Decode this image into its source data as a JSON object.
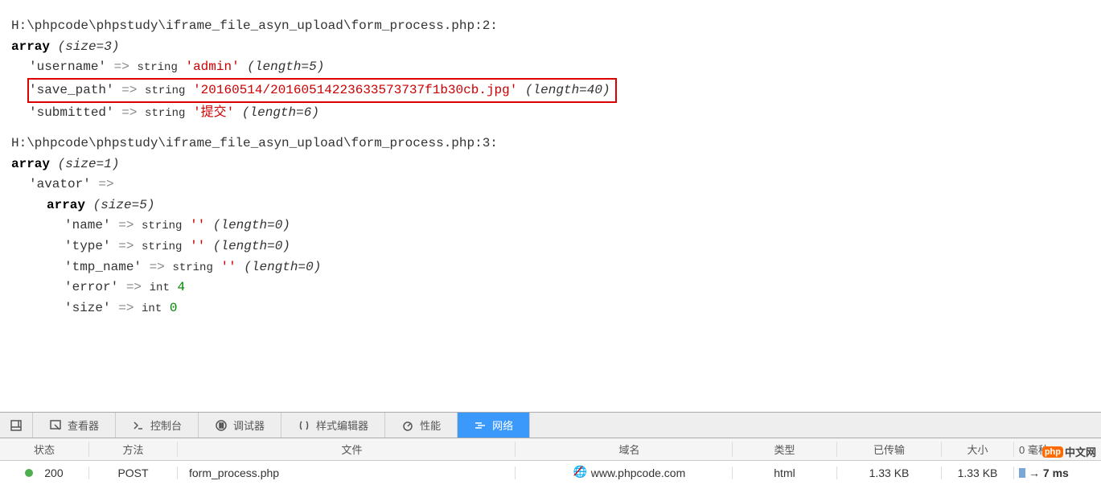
{
  "dump1": {
    "path": "H:\\phpcode\\phpstudy\\iframe_file_asyn_upload\\form_process.php:2:",
    "size_label": "(size=3)",
    "rows": [
      {
        "key": "'username'",
        "type": "string",
        "value": "'admin'",
        "len": "(length=5)",
        "highlight": false
      },
      {
        "key": "'save_path'",
        "type": "string",
        "value": "'20160514/20160514223633573737f1b30cb.jpg'",
        "len": "(length=40)",
        "highlight": true
      },
      {
        "key": "'submitted'",
        "type": "string",
        "value": "'提交'",
        "len": "(length=6)",
        "highlight": false
      }
    ]
  },
  "dump2": {
    "path": "H:\\phpcode\\phpstudy\\iframe_file_asyn_upload\\form_process.php:3:",
    "outer_size": "(size=1)",
    "outer_key": "'avator'",
    "inner_size": "(size=5)",
    "rows": [
      {
        "key": "'name'",
        "type": "string",
        "value": "''",
        "len": "(length=0)"
      },
      {
        "key": "'type'",
        "type": "string",
        "value": "''",
        "len": "(length=0)"
      },
      {
        "key": "'tmp_name'",
        "type": "string",
        "value": "''",
        "len": "(length=0)"
      },
      {
        "key": "'error'",
        "type": "int",
        "value": "4",
        "len": ""
      },
      {
        "key": "'size'",
        "type": "int",
        "value": "0",
        "len": ""
      }
    ]
  },
  "tabs": {
    "inspector": "查看器",
    "console": "控制台",
    "debugger": "调试器",
    "style": "样式编辑器",
    "performance": "性能",
    "network": "网络"
  },
  "net_headers": {
    "status": "状态",
    "method": "方法",
    "file": "文件",
    "domain": "域名",
    "type": "类型",
    "transferred": "已传输",
    "size": "大小",
    "timeline": "0 毫秒"
  },
  "net_row": {
    "status": "200",
    "method": "POST",
    "file": "form_process.php",
    "domain": "www.phpcode.com",
    "type": "html",
    "transferred": "1.33 KB",
    "size": "1.33 KB",
    "time": "→ 7 ms"
  },
  "array_kw": "array",
  "arrow": "=>",
  "logo": {
    "php": "php",
    "cn": "中文网"
  }
}
